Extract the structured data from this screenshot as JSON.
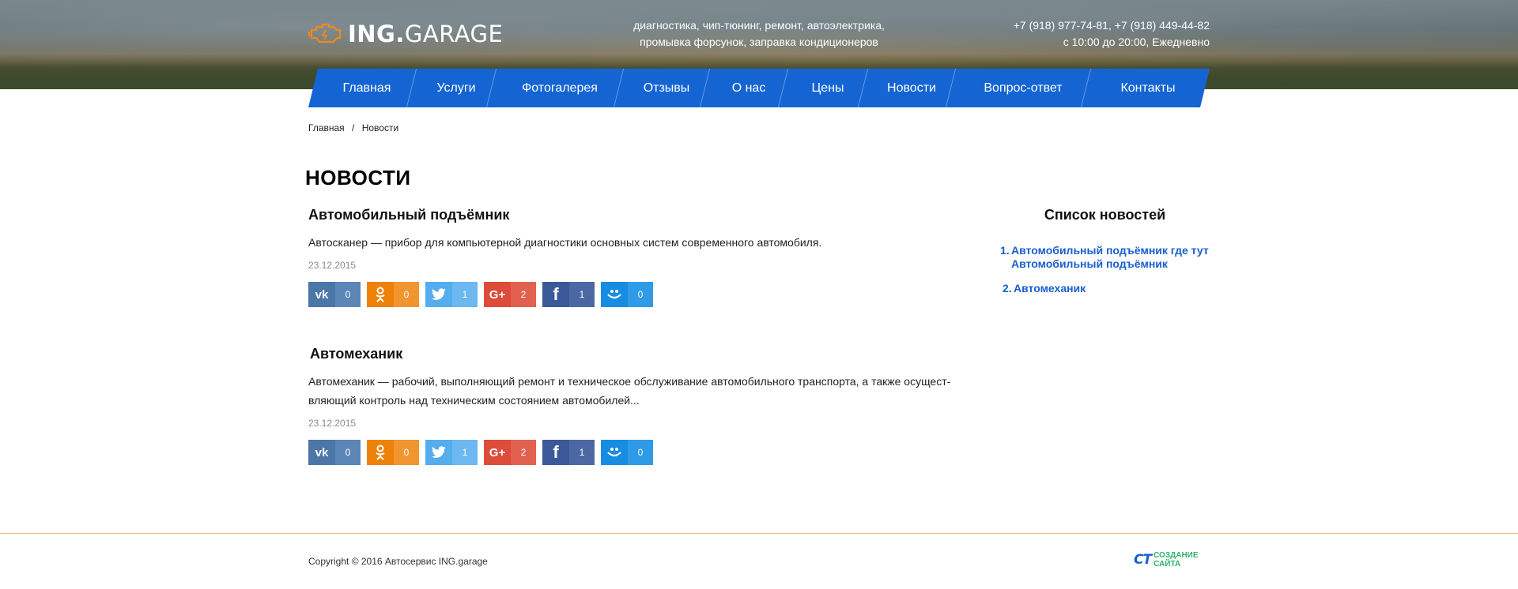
{
  "header": {
    "logo": {
      "brand": "ING.",
      "name": "GARAGE"
    },
    "tagline": {
      "line1": "диагностика, чип-тюнинг, ремонт, автоэлектрика,",
      "line2": "промывка форсунок, заправка кондиционеров"
    },
    "contacts": {
      "phones": "+7 (918) 977-74-81,  +7 (918) 449-44-82",
      "hours": "с 10:00 до 20:00, Ежедневно"
    }
  },
  "nav": {
    "items": [
      {
        "label": "Главная"
      },
      {
        "label": "Услуги"
      },
      {
        "label": "Фотогалерея"
      },
      {
        "label": "Отзывы"
      },
      {
        "label": "О нас"
      },
      {
        "label": "Цены"
      },
      {
        "label": "Новости"
      },
      {
        "label": "Вопрос-ответ"
      },
      {
        "label": "Контакты"
      }
    ],
    "accent": "#1465d3"
  },
  "breadcrumb": {
    "home": "Главная",
    "sep": "/",
    "current": "Новости"
  },
  "page_title": "НОВОСТИ",
  "news": [
    {
      "title": "Автомобильный подъёмник",
      "text": "Автосканер — прибор для компьютерной диагностики основных систем современного автомобиля.",
      "date": "23.12.2015",
      "shares": {
        "vk": "0",
        "ok": "0",
        "tw": "1",
        "gp": "2",
        "fb": "1",
        "mm": "0"
      }
    },
    {
      "title": "Автомеханик",
      "text_line1": "Автомеханик — рабочий, выполняющий ремонт и техническое обслуживание автомобильного транспорта, а также осущест-",
      "text_line2": "вляющий контроль над техническим состоянием автомобилей...",
      "date": "23.12.2015",
      "shares": {
        "vk": "0",
        "ok": "0",
        "tw": "1",
        "gp": "2",
        "fb": "1",
        "mm": "0"
      }
    }
  ],
  "share_colors": {
    "vk": "#4a76a8",
    "ok": "#ee8208",
    "tw": "#55acee",
    "gp": "#dd4b39",
    "fb": "#3b5998",
    "mm": "#168de2"
  },
  "share_icons": {
    "vk": "vk-icon",
    "ok": "odnoklassniki-icon",
    "tw": "twitter-icon",
    "gp": "google-plus-icon",
    "fb": "facebook-icon",
    "mm": "mailru-icon"
  },
  "sidebar": {
    "title": "Список новостей",
    "items": [
      {
        "num": "1.",
        "line1": "Автомобильный подъёмник где тут",
        "line2": "Автомобильный подъёмник"
      },
      {
        "num": "2.",
        "line1": "Автомеханик"
      }
    ]
  },
  "footer": {
    "copyright": "Copyright © 2016 Автосервис ING.garage",
    "creator_mark": "СТ",
    "creator_line1": "СОЗДАНИЕ",
    "creator_line2": "САЙТА"
  }
}
